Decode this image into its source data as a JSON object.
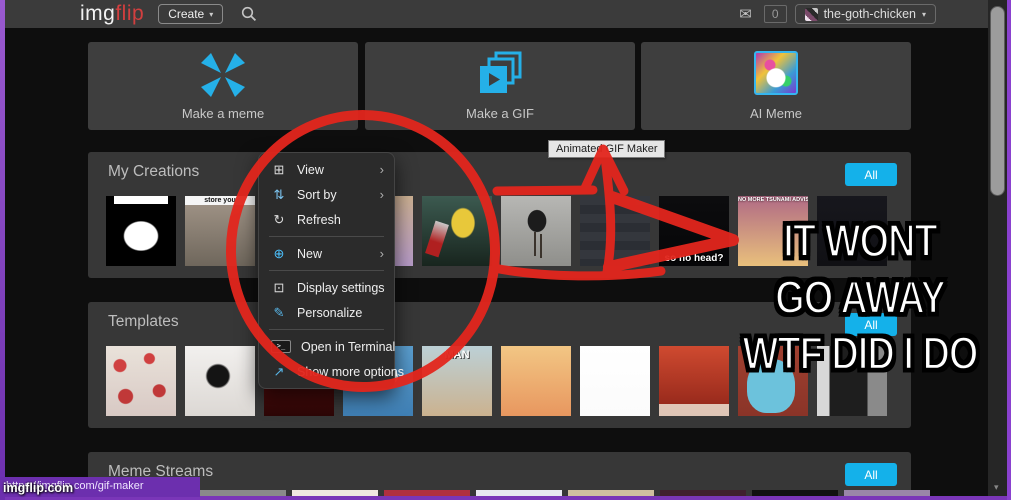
{
  "colors": {
    "accent_blue": "#14b1ea",
    "imgflip_blue": "#25b0e8",
    "annotation_red": "#e3261d",
    "desktop_purple": "#8a41cf",
    "panel_gray": "#373737",
    "topbar_gray": "#3b3b3b"
  },
  "icons": {
    "mail": "✉",
    "dropdown_caret": "▾",
    "submenu_chevron": "›",
    "scroll_down": "▾"
  },
  "topbar": {
    "logo_img": "img",
    "logo_flip": "flip",
    "create_label": "Create",
    "notif_count": "0",
    "username": "the-goth-chicken"
  },
  "cards": {
    "meme_label": "Make a meme",
    "gif_label": "Make a GIF",
    "ai_label": "AI Meme"
  },
  "tooltip_text": "Animated GIF Maker",
  "sections": {
    "my_creations": {
      "title": "My Creations",
      "all_label": "All",
      "thumbs": [
        {
          "name": "thumb-silhouette-meme",
          "pattern": "blob"
        },
        {
          "name": "thumb-stoat",
          "c1": "#a39689",
          "c2": "#6f675c",
          "caption": "store you",
          "cap": "strip-top"
        },
        {
          "name": "thumb-hidden-under-menu-1",
          "c1": "#5a5a5a",
          "c2": "#3c3c3c"
        },
        {
          "name": "thumb-hidden-under-menu-2",
          "c1": "#cdb193",
          "c2": "#b79bc9"
        },
        {
          "name": "thumb-corn-scream",
          "pattern": "corn"
        },
        {
          "name": "thumb-baby-bird",
          "pattern": "bird"
        },
        {
          "name": "thumb-chat-screenshot",
          "pattern": "rows"
        },
        {
          "name": "thumb-so-no-head",
          "c1": "#0c0c0e",
          "c2": "#060608",
          "caption": "so no head?",
          "cap": "impact-bottom"
        },
        {
          "name": "thumb-tsunami-sunset",
          "c1": "#b06a85",
          "c2": "#e9c07c",
          "caption": "NO MORE TSUNAMI ADVISORY",
          "cap": "tiny-top"
        },
        {
          "name": "thumb-dark-night",
          "c1": "#17171d",
          "c2": "#101014"
        }
      ]
    },
    "templates": {
      "title": "Templates",
      "all_label": "All",
      "thumbs": [
        {
          "name": "thumb-heart-collage",
          "pattern": "collage"
        },
        {
          "name": "thumb-troll-scream",
          "pattern": "scribble"
        },
        {
          "name": "thumb-red-anime",
          "c1": "#7e1212",
          "c2": "#2c0606"
        },
        {
          "name": "thumb-blue-cartoon-face",
          "pattern": "eyes"
        },
        {
          "name": "thumb-toilet-beach",
          "c1": "#bcd0d6",
          "c2": "#cbb28f",
          "caption": "MAN",
          "cap": "outline-top"
        },
        {
          "name": "thumb-sunset-stickman",
          "c1": "#f2c684",
          "c2": "#e8975f"
        },
        {
          "name": "thumb-blank-white",
          "c1": "#ffffff",
          "c2": "#fbfbfb"
        },
        {
          "name": "thumb-eggman",
          "pattern": "strip-bottom"
        },
        {
          "name": "thumb-gumball",
          "pattern": "gumball"
        },
        {
          "name": "thumb-man-photo",
          "pattern": "split"
        }
      ]
    },
    "meme_streams": {
      "title": "Meme Streams",
      "all_label": "All",
      "strip_colors": [
        "#8a8a8a",
        "#f0e8e0",
        "#b03040",
        "#e8e8f0",
        "#d0c0a0",
        "#402030",
        "#111111",
        "#9a86a8"
      ]
    }
  },
  "context_menu": {
    "items": [
      {
        "name": "menu-item-view",
        "icon_name": "view-icon",
        "icon": "⊞",
        "label": "View",
        "submenu": true
      },
      {
        "name": "menu-item-sort-by",
        "icon_name": "sort-icon",
        "icon": "⇅",
        "label": "Sort by",
        "submenu": true,
        "icon_color": "#7cc4f0"
      },
      {
        "name": "menu-item-refresh",
        "icon_name": "refresh-icon",
        "icon": "↻",
        "label": "Refresh"
      },
      {
        "type": "sep"
      },
      {
        "name": "menu-item-new",
        "icon_name": "new-icon",
        "icon": "⊕",
        "label": "New",
        "submenu": true,
        "icon_color": "#4cc2ff"
      },
      {
        "type": "sep"
      },
      {
        "name": "menu-item-display-settings",
        "icon_name": "display-settings-icon",
        "icon": "⊡",
        "label": "Display settings"
      },
      {
        "name": "menu-item-personalize",
        "icon_name": "personalize-icon",
        "icon": "✎",
        "label": "Personalize",
        "icon_color": "#58b6e8"
      },
      {
        "type": "sep"
      },
      {
        "name": "menu-item-open-in-terminal",
        "icon_name": "terminal-icon",
        "icon": ">_",
        "label": "Open in Terminal",
        "terminal": true
      },
      {
        "name": "menu-item-show-more-options",
        "icon_name": "show-more-options-icon",
        "icon": "↗",
        "label": "Show more options",
        "icon_color": "#58b6e8"
      }
    ]
  },
  "meme_text": {
    "lines": [
      "IT WONT",
      "GO AWAY",
      "WTF DID I DO"
    ]
  },
  "watermark": "imgflip.com",
  "status_url": "https://imgflip.com/gif-maker"
}
